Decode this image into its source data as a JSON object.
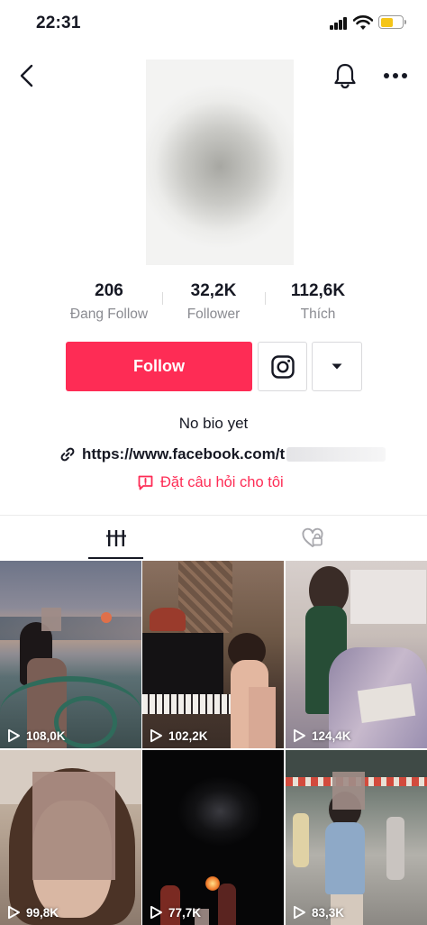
{
  "status_bar": {
    "time": "22:31"
  },
  "profile": {
    "stats": [
      {
        "value": "206",
        "label": "Đang Follow"
      },
      {
        "value": "32,2K",
        "label": "Follower"
      },
      {
        "value": "112,6K",
        "label": "Thích"
      }
    ],
    "follow_label": "Follow",
    "bio": "No bio yet",
    "link_text": "https://www.facebook.com/t",
    "ask_label": "Đặt câu hỏi cho tôi"
  },
  "icons": [
    "back-icon",
    "bell-icon",
    "more-icon",
    "instagram-icon",
    "chevron-down-icon",
    "link-icon",
    "question-icon",
    "grid-icon",
    "liked-videos-icon",
    "play-icon"
  ],
  "colors": {
    "accent": "#fe2c55",
    "text": "#161823",
    "muted": "#8a8b91"
  },
  "videos": [
    {
      "views": "108,0K"
    },
    {
      "views": "102,2K"
    },
    {
      "views": "124,4K"
    },
    {
      "views": "99,8K"
    },
    {
      "views": "77,7K"
    },
    {
      "views": "83,3K"
    }
  ]
}
